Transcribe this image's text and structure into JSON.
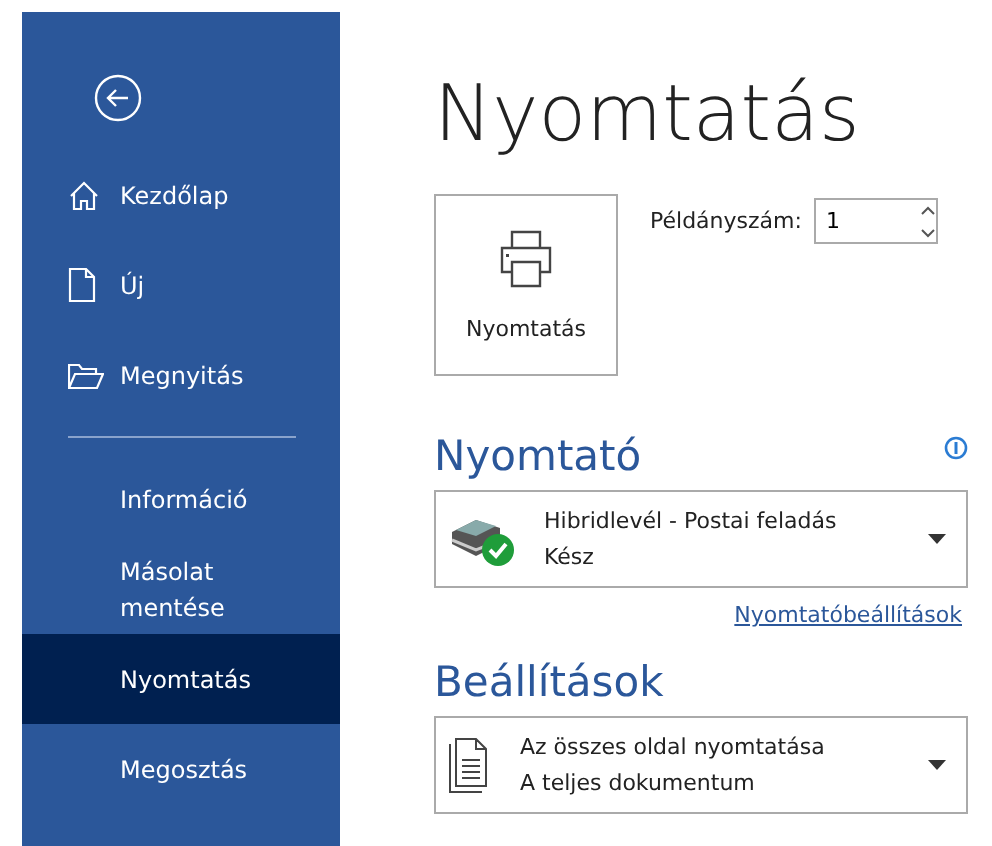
{
  "sidebar": {
    "items": [
      {
        "label": "Kezdőlap",
        "kind": "home",
        "selected": false
      },
      {
        "label": "Új",
        "kind": "new",
        "selected": false
      },
      {
        "label": "Megnyitás",
        "kind": "open",
        "selected": false
      },
      {
        "label": "Információ",
        "kind": "text",
        "selected": false,
        "divider_before": true
      },
      {
        "label": "Másolat mentése",
        "kind": "text",
        "selected": false
      },
      {
        "label": "Nyomtatás",
        "kind": "text",
        "selected": true
      },
      {
        "label": "Megosztás",
        "kind": "text",
        "selected": false
      }
    ]
  },
  "title": "Nyomtatás",
  "print_button": "Nyomtatás",
  "copies": {
    "label": "Példányszám:",
    "value": "1"
  },
  "printer": {
    "heading": "Nyomtató",
    "name": "Hibridlevél - Postai feladás",
    "status": "Kész",
    "link": "Nyomtatóbeállítások"
  },
  "settings": {
    "heading": "Beállítások",
    "line1": "Az összes oldal nyomtatása",
    "line2": "A teljes dokumentum"
  }
}
